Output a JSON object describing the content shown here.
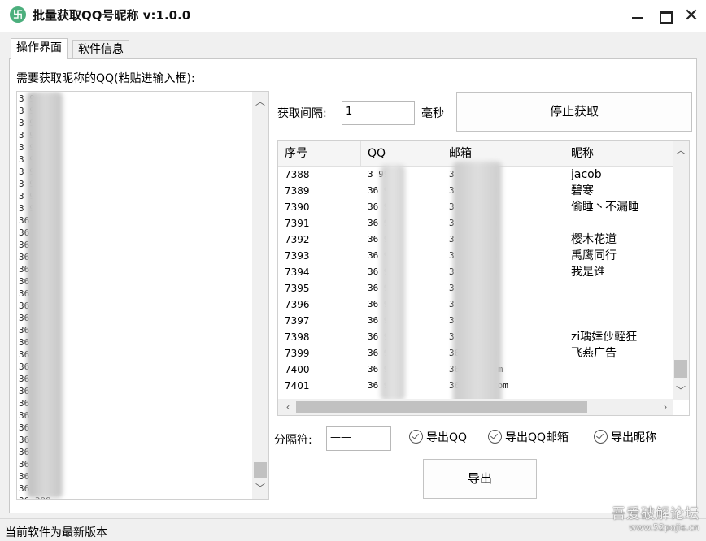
{
  "window": {
    "title": "批量获取QQ号昵称 v:1.0.0",
    "icon_glyph": "卐",
    "close_glyph": "✕"
  },
  "tabs": [
    {
      "label": "操作界面",
      "active": true
    },
    {
      "label": "软件信息",
      "active": false
    }
  ],
  "left": {
    "prompt": "需要获取昵称的QQ(粘贴进输入框):",
    "qq_lines": [
      "3  9",
      "3  9",
      "3  9",
      "3  9",
      "3  9",
      "3  9",
      "3  9",
      "3  9",
      "3  9",
      "3  9",
      "36  9",
      "36  99",
      "36  99",
      "36  99",
      "36  99",
      "36  99",
      "36  99",
      "36  99",
      "36  99",
      "36  99",
      "36  399",
      "36  799",
      "36  399",
      "36  399",
      "36  399",
      "36  399",
      "36  399",
      "36  399",
      "36  399",
      "36  399",
      "36  399",
      "36  399",
      "36  399",
      "36  399",
      "36  399",
      "36  399"
    ]
  },
  "controls": {
    "interval_label": "获取间隔:",
    "interval_value": "1",
    "interval_unit": "毫秒",
    "stop_button": "停止获取",
    "separator_label": "分隔符:",
    "separator_value": "——",
    "export_qq": "导出QQ",
    "export_qq_email": "导出QQ邮箱",
    "export_nickname": "导出昵称",
    "export_button": "导出"
  },
  "table": {
    "columns": [
      "序号",
      "QQ",
      "邮箱",
      "昵称"
    ],
    "rows": [
      {
        "seq": "7388",
        "qq": "3  99",
        "email": "3  @qq.com",
        "nick": "jacob"
      },
      {
        "seq": "7389",
        "qq": "36  99",
        "email": "3  @qq.com",
        "nick": "碧寒"
      },
      {
        "seq": "7390",
        "qq": "36  99",
        "email": "3  @qq.com",
        "nick": "偷睡丶不漏睡"
      },
      {
        "seq": "7391",
        "qq": "36  99",
        "email": "3  @qq.com",
        "nick": ""
      },
      {
        "seq": "7392",
        "qq": "36  99",
        "email": "3  @qq.com",
        "nick": "樱木花道"
      },
      {
        "seq": "7393",
        "qq": "36  99",
        "email": "3  @qq.com",
        "nick": "禹鹰同行"
      },
      {
        "seq": "7394",
        "qq": "36  99",
        "email": "3  @qq.com",
        "nick": "我是谁"
      },
      {
        "seq": "7395",
        "qq": "36  99",
        "email": "3  qq.com",
        "nick": ""
      },
      {
        "seq": "7396",
        "qq": "36  99",
        "email": "3  qq.com",
        "nick": ""
      },
      {
        "seq": "7397",
        "qq": "36  99",
        "email": "3  qq.com",
        "nick": ""
      },
      {
        "seq": "7398",
        "qq": "36  99",
        "email": "3  qq.com",
        "nick": "zi瑀婞仯輊狂"
      },
      {
        "seq": "7399",
        "qq": "36  99",
        "email": "36  qq.com",
        "nick": "飞燕广告"
      },
      {
        "seq": "7400",
        "qq": "36  99",
        "email": "367  qq.com",
        "nick": ""
      },
      {
        "seq": "7401",
        "qq": "36  99",
        "email": "3674  qq.com",
        "nick": ""
      }
    ]
  },
  "status": {
    "text": "当前软件为最新版本"
  },
  "watermark": {
    "line1": "吾爱破解论坛",
    "line2": "www.52pojie.cn"
  }
}
